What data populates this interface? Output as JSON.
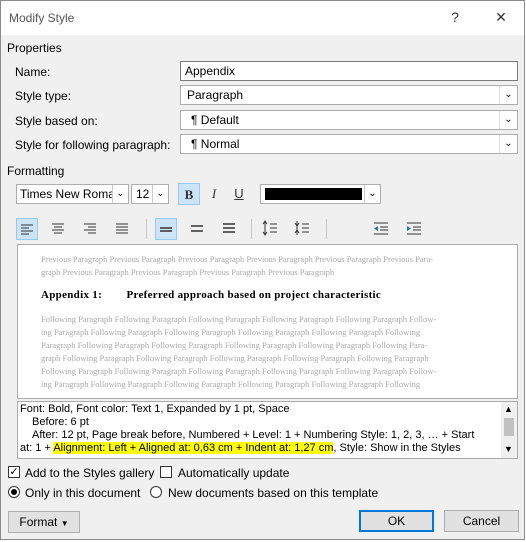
{
  "window": {
    "title": "Modify Style",
    "help_label": "?",
    "close_label": "✕"
  },
  "properties": {
    "section_label": "Properties",
    "name_label": "Name:",
    "name_value": "Appendix",
    "type_label": "Style type:",
    "type_value": "Paragraph",
    "based_label": "Style based on:",
    "based_value": "¶  Default",
    "following_label": "Style for following paragraph:",
    "following_value": "¶  Normal"
  },
  "formatting": {
    "section_label": "Formatting",
    "font": "Times New Roman",
    "size": "12",
    "bold": "B",
    "italic": "I",
    "underline": "U",
    "font_color": "#000000"
  },
  "preview": {
    "previous_lines": [
      "Previous Paragraph Previous Paragraph Previous Paragraph Previous Paragraph Previous Paragraph Previous Para-",
      "graph Previous Paragraph Previous Paragraph Previous Paragraph Previous Paragraph"
    ],
    "heading": "Appendix 1:        Preferred approach based on project characteristic",
    "following_lines": [
      "Following Paragraph Following Paragraph Following Paragraph Following Paragraph Following Paragraph Follow-",
      "ing Paragraph Following Paragraph Following Paragraph Following Paragraph Following Paragraph Following",
      "Paragraph Following Paragraph Following Paragraph Following Paragraph Following Paragraph Following Para-",
      "graph Following Paragraph Following Paragraph Following Paragraph Following Paragraph Following Paragraph",
      "Following Paragraph Following Paragraph Following Paragraph Following Paragraph Following Paragraph Follow-",
      "ing Paragraph Following Paragraph Following Paragraph Following Paragraph Following Paragraph Following"
    ]
  },
  "description": {
    "line1": "Font: Bold, Font color: Text 1, Expanded by  1 pt, Space",
    "line2": "Before:  6 pt",
    "line3": "After:  12 pt, Page break before, Numbered + Level: 1 + Numbering Style: 1, 2, 3, … + Start",
    "line4_pre": "at: 1 + ",
    "line4_highlight": "Alignment: Left + Aligned at:  0,63 cm + Indent at:  1,27 cm",
    "line4_post": ", Style: Show in the Styles"
  },
  "options": {
    "add_gallery": "Add to the Styles gallery",
    "add_gallery_checked": true,
    "auto_update": "Automatically update",
    "auto_update_checked": false,
    "only_doc": "Only in this document",
    "new_docs": "New documents based on this template"
  },
  "buttons": {
    "format": "Format",
    "ok": "OK",
    "cancel": "Cancel"
  },
  "colors": {
    "accent": "#0078d7",
    "highlight": "#ffff00",
    "toggle_on": "#cce4f7"
  }
}
